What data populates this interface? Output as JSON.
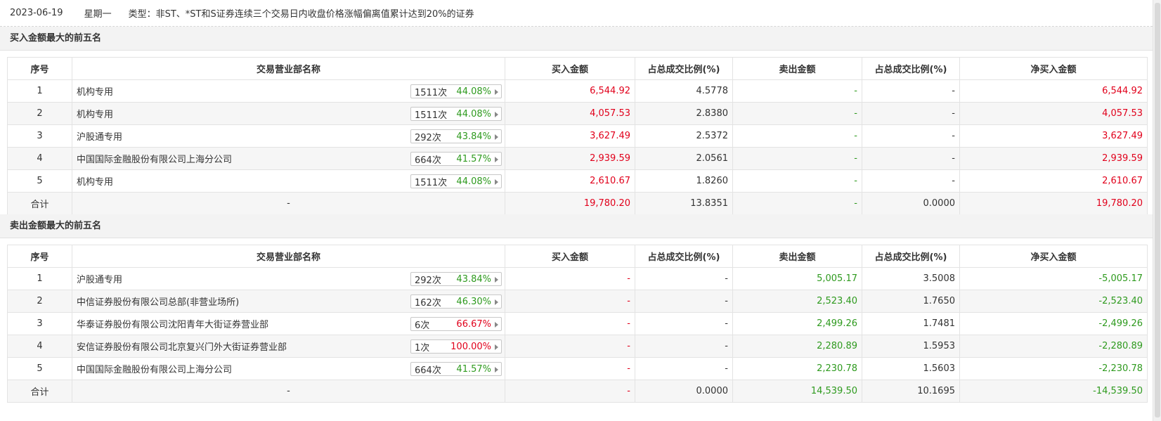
{
  "header": {
    "date": "2023-06-19",
    "weekday": "星期一",
    "type_text": "类型：非ST、*ST和S证券连续三个交易日内收盘价格涨幅偏离值累计达到20%的证券"
  },
  "colors": {
    "up": "#e1001b",
    "down": "#2e9a1e"
  },
  "columns": [
    "序号",
    "交易营业部名称",
    "买入金额",
    "占总成交比例(%)",
    "卖出金额",
    "占总成交比例(%)",
    "净买入金额"
  ],
  "buy_section": {
    "title": "买入金额最大的前五名",
    "rows": [
      {
        "rank": "1",
        "name": "机构专用",
        "times": "1511次",
        "pct": "44.08%",
        "pct_color": "green",
        "buy": "6,544.92",
        "buy_ratio": "4.5778",
        "sell": "-",
        "sell_ratio": "-",
        "net": "6,544.92"
      },
      {
        "rank": "2",
        "name": "机构专用",
        "times": "1511次",
        "pct": "44.08%",
        "pct_color": "green",
        "buy": "4,057.53",
        "buy_ratio": "2.8380",
        "sell": "-",
        "sell_ratio": "-",
        "net": "4,057.53"
      },
      {
        "rank": "3",
        "name": "沪股通专用",
        "times": "292次",
        "pct": "43.84%",
        "pct_color": "green",
        "buy": "3,627.49",
        "buy_ratio": "2.5372",
        "sell": "-",
        "sell_ratio": "-",
        "net": "3,627.49"
      },
      {
        "rank": "4",
        "name": "中国国际金融股份有限公司上海分公司",
        "times": "664次",
        "pct": "41.57%",
        "pct_color": "green",
        "buy": "2,939.59",
        "buy_ratio": "2.0561",
        "sell": "-",
        "sell_ratio": "-",
        "net": "2,939.59"
      },
      {
        "rank": "5",
        "name": "机构专用",
        "times": "1511次",
        "pct": "44.08%",
        "pct_color": "green",
        "buy": "2,610.67",
        "buy_ratio": "1.8260",
        "sell": "-",
        "sell_ratio": "-",
        "net": "2,610.67"
      }
    ],
    "total": {
      "label": "合计",
      "name": "-",
      "buy": "19,780.20",
      "buy_ratio": "13.8351",
      "sell": "-",
      "sell_ratio": "0.0000",
      "net": "19,780.20"
    }
  },
  "sell_section": {
    "title": "卖出金额最大的前五名",
    "rows": [
      {
        "rank": "1",
        "name": "沪股通专用",
        "times": "292次",
        "pct": "43.84%",
        "pct_color": "green",
        "buy": "-",
        "buy_ratio": "-",
        "sell": "5,005.17",
        "sell_ratio": "3.5008",
        "net": "-5,005.17"
      },
      {
        "rank": "2",
        "name": "中信证券股份有限公司总部(非营业场所)",
        "times": "162次",
        "pct": "46.30%",
        "pct_color": "green",
        "buy": "-",
        "buy_ratio": "-",
        "sell": "2,523.40",
        "sell_ratio": "1.7650",
        "net": "-2,523.40"
      },
      {
        "rank": "3",
        "name": "华泰证券股份有限公司沈阳青年大街证券营业部",
        "times": "6次",
        "pct": "66.67%",
        "pct_color": "red",
        "buy": "-",
        "buy_ratio": "-",
        "sell": "2,499.26",
        "sell_ratio": "1.7481",
        "net": "-2,499.26"
      },
      {
        "rank": "4",
        "name": "安信证券股份有限公司北京复兴门外大街证券营业部",
        "times": "1次",
        "pct": "100.00%",
        "pct_color": "red",
        "buy": "-",
        "buy_ratio": "-",
        "sell": "2,280.89",
        "sell_ratio": "1.5953",
        "net": "-2,280.89"
      },
      {
        "rank": "5",
        "name": "中国国际金融股份有限公司上海分公司",
        "times": "664次",
        "pct": "41.57%",
        "pct_color": "green",
        "buy": "-",
        "buy_ratio": "-",
        "sell": "2,230.78",
        "sell_ratio": "1.5603",
        "net": "-2,230.78"
      }
    ],
    "total": {
      "label": "合计",
      "name": "-",
      "buy": "-",
      "buy_ratio": "0.0000",
      "sell": "14,539.50",
      "sell_ratio": "10.1695",
      "net": "-14,539.50"
    }
  }
}
